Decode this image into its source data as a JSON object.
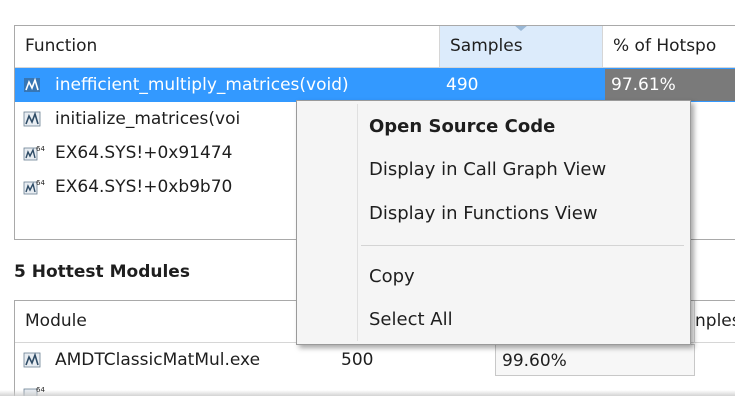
{
  "functions_table": {
    "columns": [
      "Function",
      "Samples",
      "% of Hotspo"
    ],
    "rows": [
      {
        "name": "inefficient_multiply_matrices(void)",
        "samples": "490",
        "percent": "97.61%",
        "icon": "function-icon",
        "selected": true
      },
      {
        "name": "initialize_matrices(voi",
        "samples": "",
        "percent": "",
        "icon": "function-icon",
        "selected": false
      },
      {
        "name": "EX64.SYS!+0x91474",
        "samples": "",
        "percent": "",
        "icon": "function-64-icon",
        "selected": false
      },
      {
        "name": "EX64.SYS!+0xb9b70",
        "samples": "",
        "percent": "",
        "icon": "function-64-icon",
        "selected": false
      }
    ]
  },
  "modules_section": {
    "title": "5 Hottest Modules"
  },
  "modules_table": {
    "columns": [
      "Module",
      "",
      "nples"
    ],
    "rows": [
      {
        "name": "AMDTClassicMatMul.exe",
        "samples": "500",
        "percent": "99.60%",
        "icon": "module-icon"
      }
    ]
  },
  "context_menu": {
    "items": [
      {
        "label": "Open Source Code",
        "bold": true
      },
      {
        "label": "Display in Call Graph View",
        "bold": false
      },
      {
        "label": "Display in Functions View",
        "bold": false
      },
      {
        "label": "Copy",
        "bold": false
      },
      {
        "label": "Select All",
        "bold": false
      }
    ]
  },
  "colors": {
    "selection": "#3399ff",
    "sorted_header": "#dcebfb",
    "percent_bar": "#7a7a7a",
    "menu_background": "#f5f5f5"
  }
}
